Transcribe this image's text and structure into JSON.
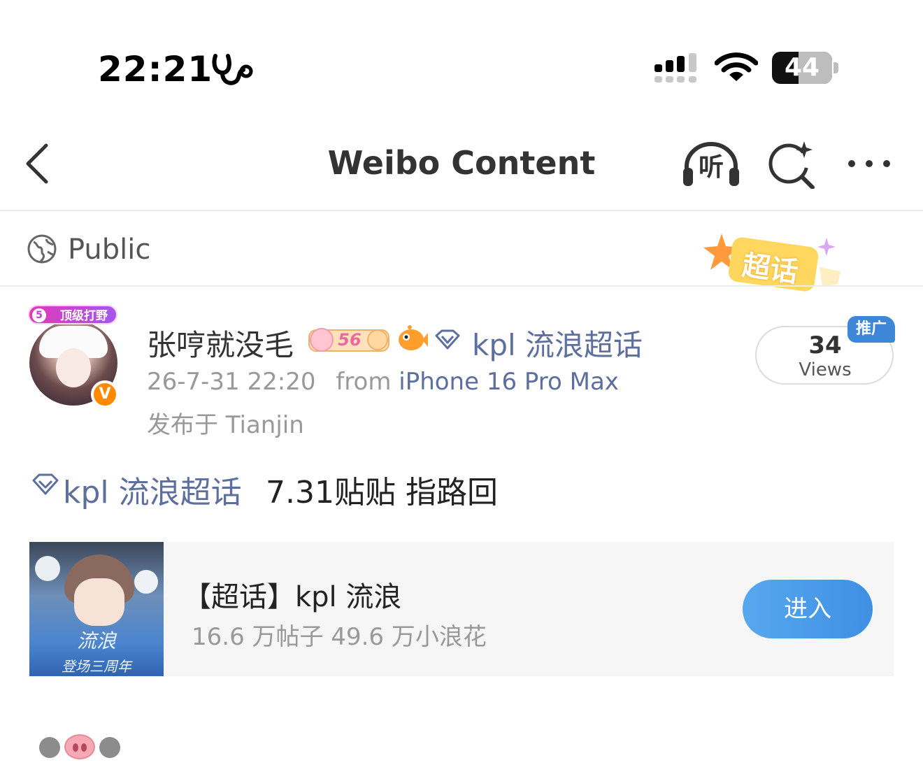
{
  "status_bar": {
    "time": "22:21",
    "battery_percent": "44",
    "battery_level": 0.44,
    "signal_bars_active": 3,
    "focus_icon": "stethoscope-icon"
  },
  "nav": {
    "title": "Weibo Content",
    "listen_label": "听",
    "icons": [
      "back-icon",
      "headphones-icon",
      "ai-search-icon",
      "more-icon"
    ]
  },
  "visibility": {
    "label": "Public",
    "supertopic_badge": "超话"
  },
  "author": {
    "avatar_tag": "顶级打野",
    "avatar_tag_num": "5",
    "verified_mark": "V",
    "name": "张哼就没毛",
    "medal_level": "56",
    "topic": "kpl 流浪超话",
    "timestamp": "26-7-31 22:20",
    "from_label": "from",
    "device": "iPhone 16 Pro Max",
    "location": "发布于 Tianjin"
  },
  "views": {
    "count": "34",
    "label": "Views",
    "promo_tag": "推广"
  },
  "post": {
    "topic": "kpl 流浪超话",
    "text": "7.31贴贴 指路回"
  },
  "topic_card": {
    "title": "【超话】kpl 流浪",
    "stats": "16.6 万帖子 49.6 万小浪花",
    "cover_text_1": "流浪",
    "cover_text_2": "登场三周年",
    "enter_label": "进入"
  },
  "colors": {
    "link": "#5d6f9e",
    "enter_button": "#4a9be9",
    "verified": "#ff8a00",
    "promo": "#3d86d8"
  }
}
